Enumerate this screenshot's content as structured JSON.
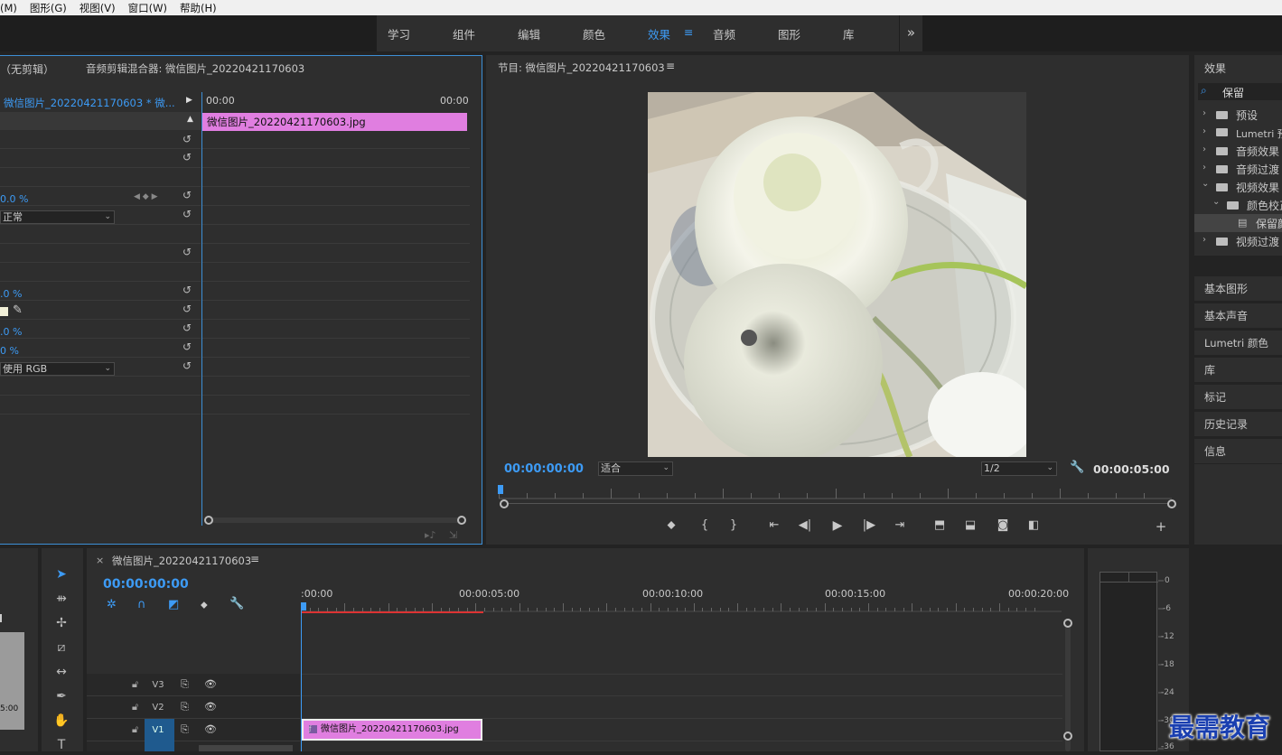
{
  "menubar": {
    "items": [
      "(M)",
      "图形(G)",
      "视图(V)",
      "窗口(W)",
      "帮助(H)"
    ]
  },
  "workspaces": {
    "tabs": [
      "学习",
      "组件",
      "编辑",
      "颜色",
      "效果",
      "音频",
      "图形",
      "库"
    ],
    "active": "效果",
    "more": "»"
  },
  "source_panel": {
    "tab1": "（无剪辑）",
    "tab2": "音频剪辑混合器: 微信图片_20220421170603",
    "clip_path": "微信图片_20220421170603 * 微...",
    "timecode_start": "00:00",
    "timecode_end": "00:00",
    "clip_label": "微信图片_20220421170603.jpg",
    "props": {
      "opacity": "0.0 %",
      "blend_mode": "正常",
      "value_a": ".0 %",
      "value_b": ".0 %",
      "value_c": "0 %",
      "color_mode": "使用 RGB"
    }
  },
  "program_monitor": {
    "title": "节目: 微信图片_20220421170603",
    "timecode_current": "00:00:00:00",
    "fit": "适合",
    "resolution": "1/2",
    "timecode_duration": "00:00:05:00"
  },
  "effects_panel": {
    "title": "效果",
    "search_value": "保留",
    "tree": [
      {
        "label": "预设",
        "expanded": false,
        "indent": 0
      },
      {
        "label": "Lumetri 预设",
        "expanded": false,
        "indent": 0
      },
      {
        "label": "音频效果",
        "expanded": false,
        "indent": 0
      },
      {
        "label": "音频过渡",
        "expanded": false,
        "indent": 0
      },
      {
        "label": "视频效果",
        "expanded": true,
        "indent": 0
      },
      {
        "label": "颜色校正",
        "expanded": true,
        "indent": 1
      },
      {
        "label": "保留颜色",
        "expanded": false,
        "indent": 2,
        "selected": true
      },
      {
        "label": "视频过渡",
        "expanded": false,
        "indent": 0
      }
    ],
    "side_links": [
      "基本图形",
      "基本声音",
      "Lumetri 颜色",
      "库",
      "标记",
      "历史记录",
      "信息"
    ]
  },
  "project_bin": {
    "timecode": "5:00"
  },
  "timeline": {
    "close": "×",
    "title": "微信图片_20220421170603",
    "timecode": "00:00:00:00",
    "ruler": [
      ":00:00",
      "00:00:05:00",
      "00:00:10:00",
      "00:00:15:00",
      "00:00:20:00"
    ],
    "tracks": [
      "V3",
      "V2",
      "V1"
    ],
    "clip_label": "微信图片_20220421170603.jpg"
  },
  "audio_meter": {
    "labels": [
      "0",
      "-6",
      "-12",
      "-18",
      "-24",
      "-30",
      "-36"
    ]
  },
  "watermark": "最需教育",
  "colors": {
    "accent": "#3d9bf5",
    "clip": "#e07ee0",
    "panel": "#2e2e2e",
    "bg": "#232323"
  }
}
